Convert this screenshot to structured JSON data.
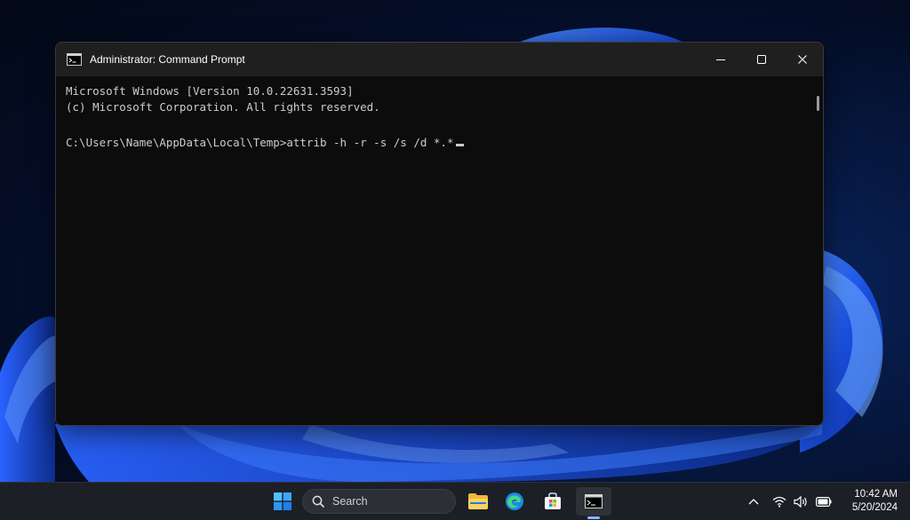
{
  "window": {
    "title": "Administrator: Command Prompt",
    "icon": "cmd-icon",
    "controls": [
      "minimize-icon",
      "maximize-icon",
      "close-icon"
    ]
  },
  "console": {
    "lines": [
      "Microsoft Windows [Version 10.0.22631.3593]",
      "(c) Microsoft Corporation. All rights reserved.",
      "",
      "C:\\Users\\Name\\AppData\\Local\\Temp>attrib -h -r -s /s /d *.*"
    ]
  },
  "taskbar": {
    "search_label": "Search",
    "apps": [
      "windows-start-icon",
      "file-explorer-icon",
      "edge-icon",
      "store-icon",
      "terminal-icon"
    ],
    "tray_icons": [
      "chevron-up-icon",
      "wifi-icon",
      "volume-icon",
      "battery-icon"
    ],
    "time": "10:42 AM",
    "date": "5/20/2024"
  },
  "colors": {
    "console_bg": "#0c0c0c",
    "console_text": "#cccccc",
    "titlebar": "#1f1f1f",
    "taskbar": "#1c1f26",
    "accent": "#1e6bff"
  }
}
